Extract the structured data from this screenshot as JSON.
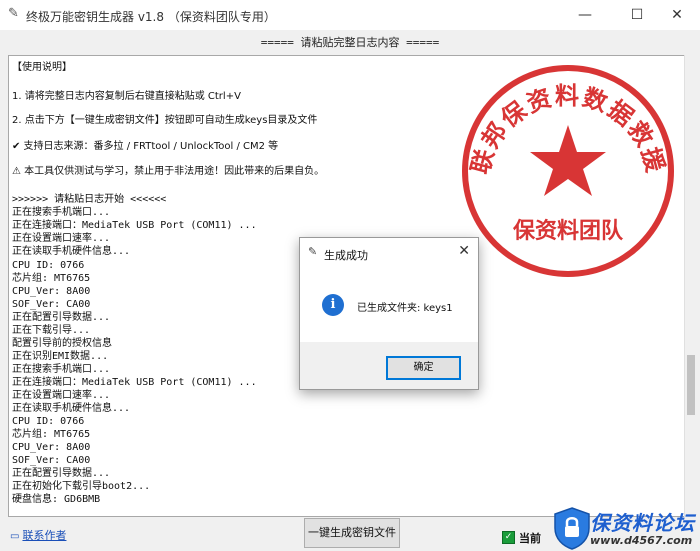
{
  "window": {
    "title": "终极万能密钥生成器 v1.8 （保资料团队专用）",
    "minimize": "—",
    "maximize": "☐",
    "close": "✕"
  },
  "header_label": "===== 请粘贴完整日志内容 =====",
  "log_lines": [
    "【使用说明】",
    "1. 请将完整日志内容复制后右键直接粘贴或 Ctrl+V",
    "2. 点击下方【一键生成密钥文件】按钮即可自动生成keys目录及文件",
    "✔ 支持日志来源：番多拉 / FRTtool / UnlockTool / CM2 等",
    "⚠ 本工具仅供测试与学习，禁止用于非法用途！因此带来的后果自负。",
    ">>>>>> 请粘贴日志开始 <<<<<<",
    "正在搜索手机端口...",
    "正在连接端口：MediaTek USB Port (COM11) ...",
    "正在设置端口速率...",
    "正在读取手机硬件信息...",
    "CPU ID: 0766",
    "芯片组: MT6765",
    "CPU_Ver: 8A00",
    "SOF_Ver: CA00",
    "正在配置引导数据...",
    "正在下载引导...",
    "配置引导前的授权信息",
    "正在识别EMI数据...",
    "正在搜索手机端口...",
    "正在连接端口：MediaTek USB Port (COM11) ...",
    "正在设置端口速率...",
    "正在读取手机硬件信息...",
    "CPU ID: 0766",
    "芯片组: MT6765",
    "CPU_Ver: 8A00",
    "SOF_Ver: CA00",
    "正在配置引导数据...",
    "正在初始化下载引导boot2...",
    "硬盘信息: GD6BMB"
  ],
  "stamp": {
    "arc_text": "联邦保资料数据救援",
    "bottom_text": "保资料团队",
    "color": "#d42020"
  },
  "dialog": {
    "title": "生成成功",
    "message": "已生成文件夹: keys1",
    "ok_label": "确定",
    "close": "✕",
    "info_icon": "i"
  },
  "footer": {
    "contact_label": "联系作者",
    "generate_button": "一键生成密钥文件",
    "checkbox_label": "当前"
  },
  "watermark": {
    "text": "保资料论坛",
    "url": "www.d4567.com"
  },
  "colors": {
    "accent": "#0078d7",
    "stamp_red": "#d42020",
    "link_blue": "#1a4fb8",
    "check_green": "#1a9c3a"
  }
}
